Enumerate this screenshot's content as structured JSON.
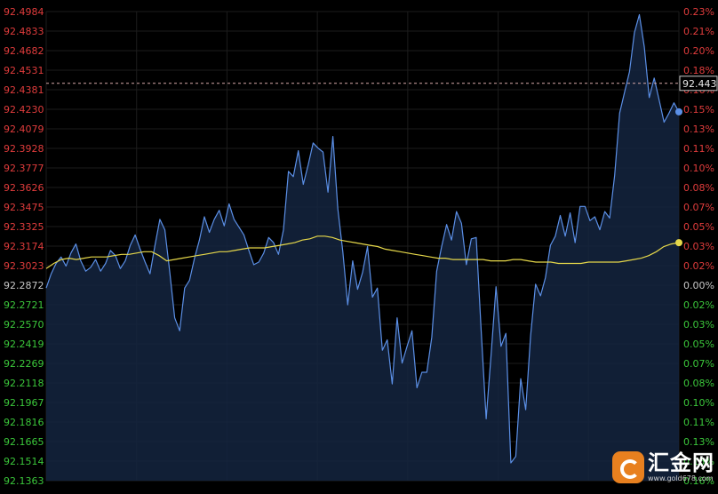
{
  "chart_data": {
    "type": "line",
    "left_ticks": [
      "92.4984",
      "92.4833",
      "92.4682",
      "92.4531",
      "92.4381",
      "92.4230",
      "92.4079",
      "92.3928",
      "92.3777",
      "92.3626",
      "92.3475",
      "92.3325",
      "92.3174",
      "92.3023",
      "92.2872",
      "92.2721",
      "92.2570",
      "92.2419",
      "92.2269",
      "92.2118",
      "92.1967",
      "92.1816",
      "92.1665",
      "92.1514",
      "92.1363"
    ],
    "right_ticks": [
      "0.23%",
      "0.21%",
      "0.20%",
      "0.18%",
      "0.16%",
      "0.15%",
      "0.13%",
      "0.11%",
      "0.10%",
      "0.08%",
      "0.07%",
      "0.05%",
      "0.03%",
      "0.02%",
      "0.00%",
      "0.02%",
      "0.03%",
      "0.05%",
      "0.07%",
      "0.08%",
      "0.10%",
      "0.11%",
      "0.13%",
      "0.15%",
      "0.16%"
    ],
    "ylim": [
      92.1363,
      92.4984
    ],
    "reference_price": 92.2872,
    "current_price_label": "92.443",
    "current_price": 92.443,
    "grid": true,
    "series": [
      {
        "color": "#5b8fe6",
        "values": [
          92.285,
          92.296,
          92.304,
          92.309,
          92.302,
          92.312,
          92.319,
          92.306,
          92.298,
          92.301,
          92.307,
          92.298,
          92.304,
          92.314,
          92.31,
          92.3,
          92.306,
          92.318,
          92.326,
          92.315,
          92.305,
          92.296,
          92.318,
          92.338,
          92.33,
          92.297,
          92.262,
          92.252,
          92.285,
          92.291,
          92.308,
          92.322,
          92.34,
          92.328,
          92.338,
          92.345,
          92.333,
          92.35,
          92.338,
          92.332,
          92.326,
          92.314,
          92.303,
          92.305,
          92.312,
          92.324,
          92.32,
          92.311,
          92.33,
          92.375,
          92.371,
          92.391,
          92.365,
          92.38,
          92.397,
          92.393,
          92.39,
          92.359,
          92.402,
          92.346,
          92.313,
          92.272,
          92.306,
          92.284,
          92.297,
          92.317,
          92.278,
          92.285,
          92.237,
          92.245,
          92.211,
          92.262,
          92.227,
          92.24,
          92.252,
          92.208,
          92.22,
          92.22,
          92.247,
          92.298,
          92.317,
          92.334,
          92.322,
          92.344,
          92.335,
          92.303,
          92.323,
          92.324,
          92.252,
          92.184,
          92.233,
          92.286,
          92.24,
          92.25,
          92.15,
          92.155,
          92.215,
          92.191,
          92.248,
          92.288,
          92.279,
          92.293,
          92.318,
          92.325,
          92.341,
          92.325,
          92.343,
          92.32,
          92.348,
          92.348,
          92.337,
          92.34,
          92.33,
          92.344,
          92.339,
          92.372,
          92.42,
          92.436,
          92.452,
          92.482,
          92.496,
          92.471,
          92.432,
          92.447,
          92.43,
          92.413,
          92.42,
          92.428,
          92.421
        ]
      },
      {
        "color": "#e6d84a",
        "values": [
          92.3,
          92.304,
          92.307,
          92.308,
          92.307,
          92.308,
          92.309,
          92.309,
          92.309,
          92.31,
          92.311,
          92.311,
          92.312,
          92.313,
          92.313,
          92.31,
          92.306,
          92.307,
          92.308,
          92.309,
          92.31,
          92.311,
          92.312,
          92.313,
          92.313,
          92.314,
          92.315,
          92.316,
          92.316,
          92.316,
          92.317,
          92.318,
          92.319,
          92.32,
          92.322,
          92.323,
          92.325,
          92.325,
          92.324,
          92.322,
          92.321,
          92.32,
          92.319,
          92.318,
          92.317,
          92.315,
          92.314,
          92.313,
          92.312,
          92.311,
          92.31,
          92.309,
          92.308,
          92.308,
          92.307,
          92.307,
          92.307,
          92.307,
          92.307,
          92.306,
          92.306,
          92.306,
          92.307,
          92.307,
          92.306,
          92.305,
          92.305,
          92.305,
          92.304,
          92.304,
          92.304,
          92.304,
          92.305,
          92.305,
          92.305,
          92.305,
          92.305,
          92.306,
          92.307,
          92.308,
          92.31,
          92.313,
          92.317,
          92.319,
          92.32
        ]
      }
    ]
  },
  "watermark": {
    "title": "汇金网",
    "url": "www.gold678.com",
    "logo": "gold678-logo-icon"
  },
  "colors": {
    "background": "#000000",
    "grid": "#1c1c1c",
    "up_tick": "#e03c3c",
    "down_tick": "#3bc73b",
    "neutral_tick": "#c8c8c8",
    "price_line": "#5b8fe6",
    "average_line": "#e6d84a",
    "current_price_line": "#d8a8a8",
    "area_fill": "#14243f"
  }
}
